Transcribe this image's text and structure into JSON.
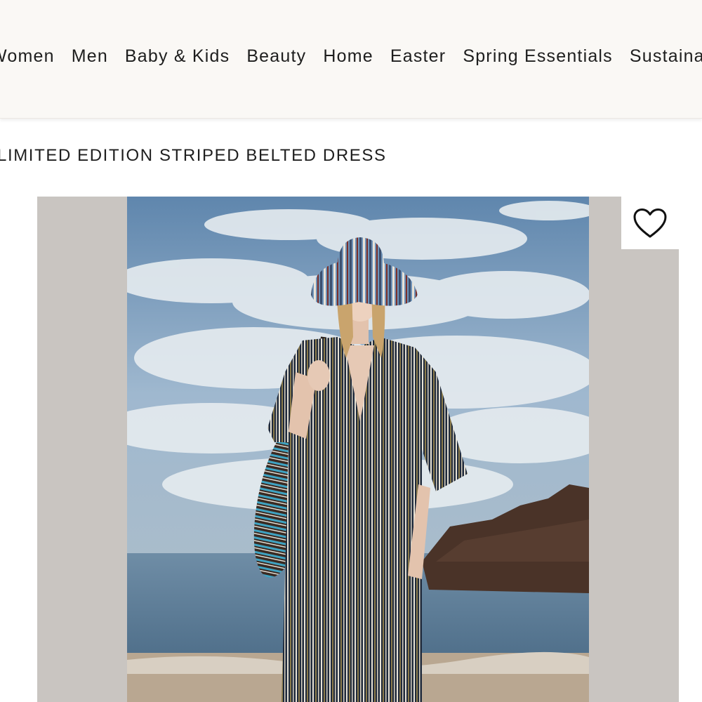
{
  "nav": {
    "items": [
      {
        "label": "Women"
      },
      {
        "label": "Men"
      },
      {
        "label": "Baby & Kids"
      },
      {
        "label": "Beauty"
      },
      {
        "label": "Home"
      },
      {
        "label": "Easter"
      },
      {
        "label": "Spring Essentials"
      },
      {
        "label": "Sustainability"
      }
    ]
  },
  "product": {
    "title": "LIMITED EDITION STRIPED BELTED DRESS",
    "wishlist_icon": "heart-outline-icon"
  },
  "colors": {
    "nav_background": "#faf8f5",
    "image_background": "#c9c5c1"
  }
}
